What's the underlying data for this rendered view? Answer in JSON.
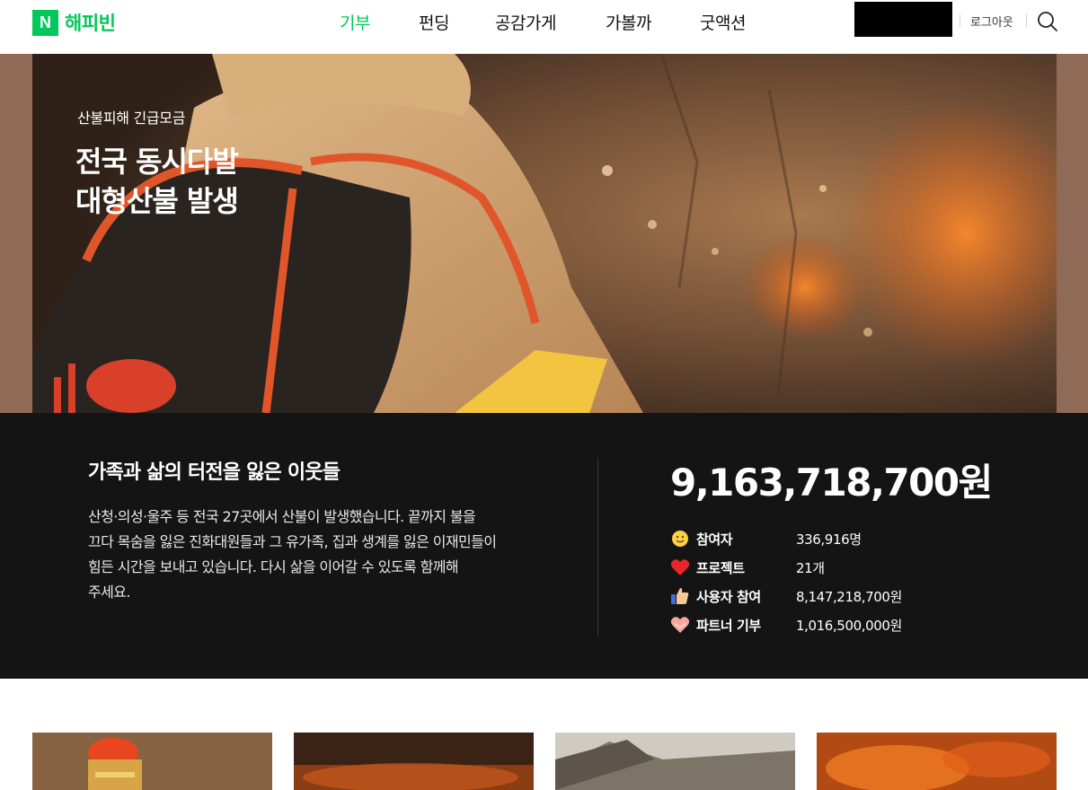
{
  "header": {
    "logo_badge": "N",
    "logo_text": "해피빈",
    "nav": [
      {
        "label": "기부",
        "active": true
      },
      {
        "label": "펀딩",
        "active": false
      },
      {
        "label": "공감가게",
        "active": false
      },
      {
        "label": "가볼까",
        "active": false
      },
      {
        "label": "굿액션",
        "active": false
      }
    ],
    "logout_label": "로그아웃",
    "search_icon": "search-icon"
  },
  "hero": {
    "subtitle": "산불피해 긴급모금",
    "title_line1": "전국 동시다발",
    "title_line2": "대형산불 발생"
  },
  "info": {
    "title": "가족과 삶의 터전을 잃은 이웃들",
    "description_lines": [
      "산청·의성·울주 등 전국 27곳에서 산불이 발생했습니다. 끝까지 불을",
      "끄다 목숨을 잃은 진화대원들과 그 유가족, 집과 생계를 잃은 이재민들이",
      "힘든 시간을 보내고 있습니다. 다시 삶을 이어갈 수 있도록 함께해",
      "주세요."
    ],
    "total_amount": "9,163,718,700원",
    "stats": [
      {
        "icon": "smiley-icon",
        "label": "참여자",
        "value": "336,916명"
      },
      {
        "icon": "heart-icon",
        "label": "프로젝트",
        "value": "21개"
      },
      {
        "icon": "thumbs-up-icon",
        "label": "사용자 참여",
        "value": "8,147,218,700원"
      },
      {
        "icon": "heart-hands-icon",
        "label": "파트너 기부",
        "value": "1,016,500,000원"
      }
    ]
  },
  "colors": {
    "brand_green": "#03c75a",
    "info_background": "#141414",
    "hero_side_band": "#8f6a56"
  }
}
